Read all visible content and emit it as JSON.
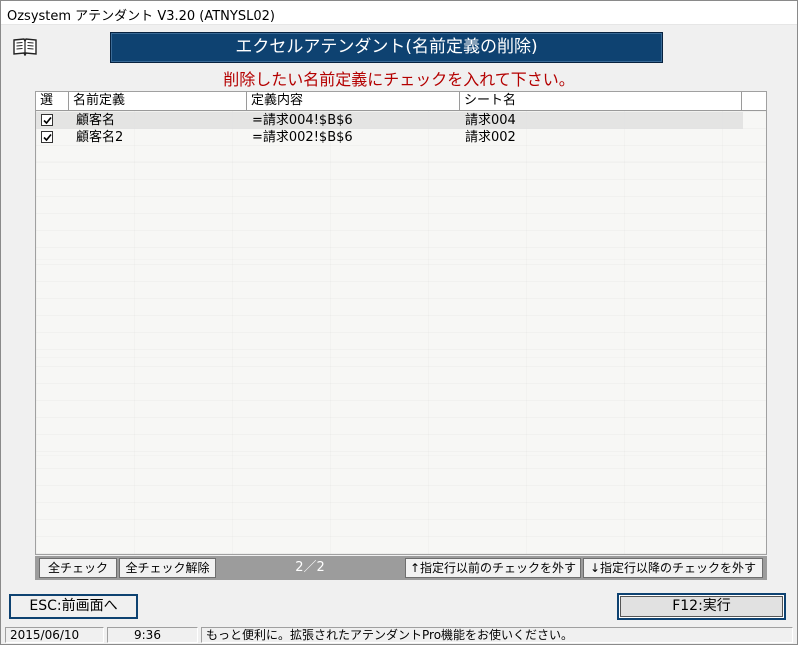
{
  "window": {
    "title": "Ozsystem アテンダント V3.20 (ATNYSL02)"
  },
  "banner": {
    "title": "エクセルアテンダント(名前定義の削除)"
  },
  "instruction": "削除したい名前定義にチェックを入れて下さい。",
  "grid": {
    "columns": [
      "選",
      "名前定義",
      "定義内容",
      "シート名"
    ],
    "rows": [
      {
        "checked": true,
        "name": "顧客名",
        "definition": "=請求004!$B$6",
        "sheet": "請求004"
      },
      {
        "checked": true,
        "name": "顧客名2",
        "definition": "=請求002!$B$6",
        "sheet": "請求002"
      }
    ]
  },
  "bottom_bar": {
    "check_all": "全チェック",
    "uncheck_all": "全チェック解除",
    "pager": "2／2",
    "uncheck_before": "↑指定行以前のチェックを外す",
    "uncheck_after": "↓指定行以降のチェックを外す"
  },
  "buttons": {
    "esc": "ESC:前画面へ",
    "f12": "F12:実行"
  },
  "status": {
    "date": "2015/06/10",
    "time": "9:36",
    "message": "もっと便利に。拡張されたアテンダントPro機能をお使いください。"
  },
  "icons": {
    "manual": "open-book-icon",
    "checkbox": "checkmark-icon"
  },
  "colors": {
    "banner_bg": "#0e4271",
    "instruction": "#b40000",
    "border_accent": "#0e4271"
  }
}
